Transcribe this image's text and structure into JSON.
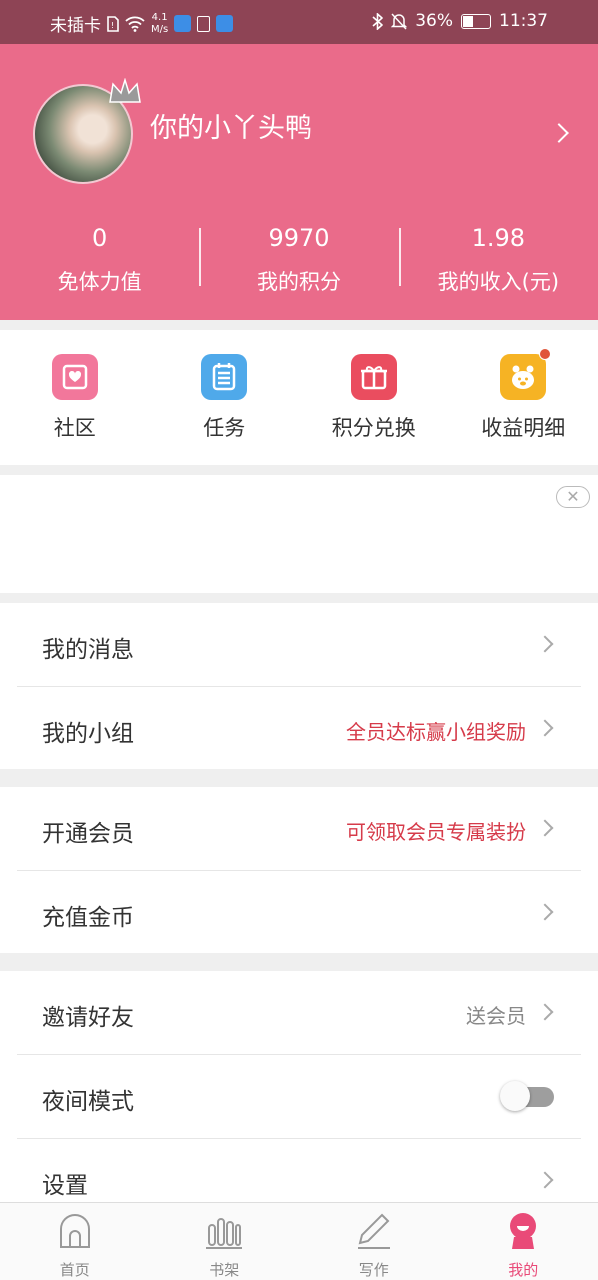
{
  "status_bar": {
    "carrier": "未插卡",
    "speed_value": "4.1",
    "speed_unit": "M/s",
    "battery": "36%",
    "time": "11:37"
  },
  "profile": {
    "nickname": "你的小丫头鸭",
    "stats": [
      {
        "value": "0",
        "label": "免体力值"
      },
      {
        "value": "9970",
        "label": "我的积分"
      },
      {
        "value": "1.98",
        "label": "我的收入(元)"
      }
    ]
  },
  "quick_actions": [
    {
      "label": "社区",
      "icon": "heart-envelope-icon",
      "color": "#f2779b"
    },
    {
      "label": "任务",
      "icon": "task-list-icon",
      "color": "#4fa9ea"
    },
    {
      "label": "积分兑换",
      "icon": "gift-icon",
      "color": "#ea4d5f"
    },
    {
      "label": "收益明细",
      "icon": "piggy-bank-icon",
      "color": "#f6b324",
      "badge": true
    }
  ],
  "banner": {
    "close_icon": "close-icon"
  },
  "menu": {
    "messages": {
      "label": "我的消息"
    },
    "group": {
      "label": "我的小组",
      "hint": "全员达标赢小组奖励"
    },
    "vip": {
      "label": "开通会员",
      "hint": "可领取会员专属装扮"
    },
    "coins": {
      "label": "充值金币"
    },
    "invite": {
      "label": "邀请好友",
      "hint": "送会员"
    },
    "night": {
      "label": "夜间模式",
      "enabled": false
    },
    "settings": {
      "label": "设置"
    }
  },
  "tabs": [
    {
      "label": "首页",
      "icon": "home-icon"
    },
    {
      "label": "书架",
      "icon": "bookshelf-icon"
    },
    {
      "label": "写作",
      "icon": "pen-icon"
    },
    {
      "label": "我的",
      "icon": "profile-icon",
      "active": true
    }
  ],
  "colors": {
    "header": "#ea6b8a",
    "status_bar": "#8e4455",
    "accent_red": "#d63b4a",
    "tab_active": "#e94a78"
  }
}
